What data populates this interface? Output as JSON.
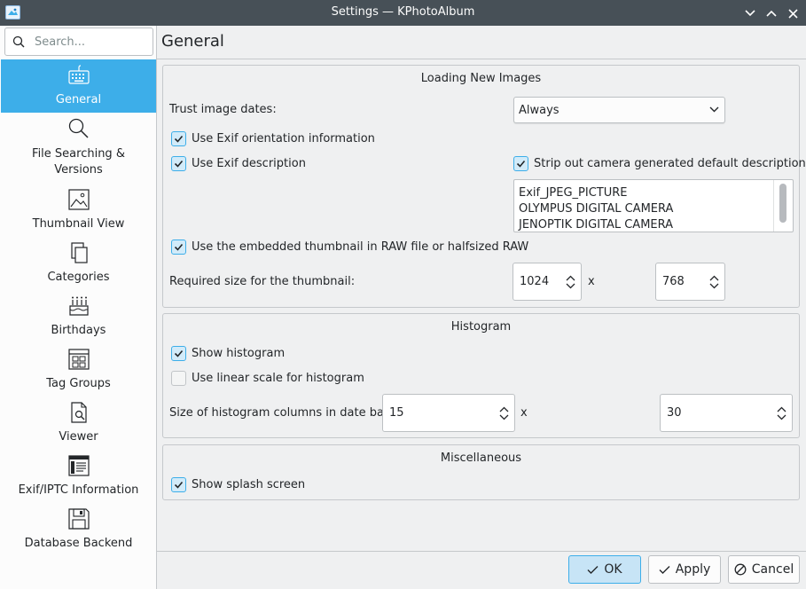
{
  "window": {
    "title": "Settings — KPhotoAlbum"
  },
  "sidebar": {
    "search_placeholder": "Search...",
    "items": [
      {
        "label": "General",
        "icon": "keyboard-icon"
      },
      {
        "label": "File Searching &\nVersions",
        "icon": "search-icon"
      },
      {
        "label": "Thumbnail View",
        "icon": "image-icon"
      },
      {
        "label": "Categories",
        "icon": "documents-icon"
      },
      {
        "label": "Birthdays",
        "icon": "cake-icon"
      },
      {
        "label": "Tag Groups",
        "icon": "grid-icon"
      },
      {
        "label": "Viewer",
        "icon": "document-search-icon"
      },
      {
        "label": "Exif/IPTC Information",
        "icon": "document-table-icon"
      },
      {
        "label": "Database Backend",
        "icon": "floppy-icon"
      }
    ]
  },
  "page": {
    "title": "General"
  },
  "loading": {
    "title": "Loading New Images",
    "trust_label": "Trust image dates:",
    "trust_value": "Always",
    "exif_orientation": "Use Exif orientation information",
    "exif_description": "Use Exif description",
    "strip_label": "Strip out camera generated default descriptions",
    "strip_list": [
      "Exif_JPEG_PICTURE",
      "OLYMPUS DIGITAL CAMERA",
      "JENOPTIK DIGITAL CAMERA"
    ],
    "embedded_thumb": "Use the embedded thumbnail in RAW file or halfsized RAW",
    "required_size_label": "Required size for the thumbnail:",
    "thumb_width": "1024",
    "thumb_height": "768",
    "x_sep": "x"
  },
  "histogram": {
    "title": "Histogram",
    "show": "Show histogram",
    "linear": "Use linear scale for histogram",
    "columns_label": "Size of histogram columns in date bar:",
    "col_width": "15",
    "col_height": "30",
    "x_sep": "x"
  },
  "misc": {
    "title": "Miscellaneous",
    "splash": "Show splash screen"
  },
  "footer": {
    "ok": "OK",
    "apply": "Apply",
    "cancel": "Cancel"
  }
}
